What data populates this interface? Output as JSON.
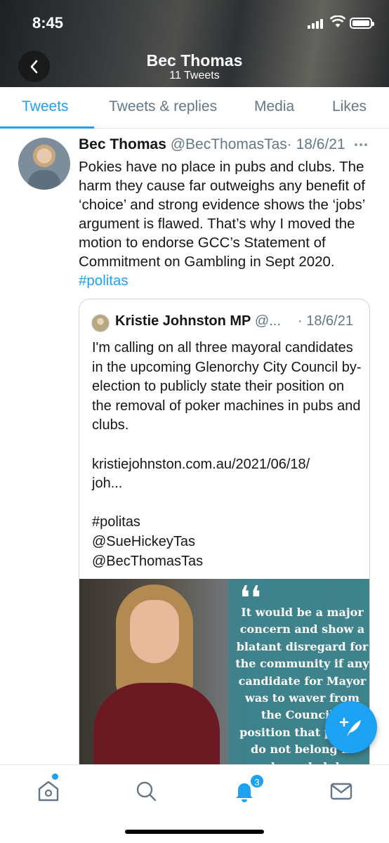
{
  "status_bar": {
    "time": "8:45"
  },
  "header": {
    "title": "Bec Thomas",
    "subtitle": "11 Tweets"
  },
  "tabs": [
    {
      "label": "Tweets",
      "active": true
    },
    {
      "label": "Tweets & replies"
    },
    {
      "label": "Media"
    },
    {
      "label": "Likes"
    }
  ],
  "tweet": {
    "name": "Bec Thomas",
    "handle": "@BecThomasTas",
    "date": "· 18/6/21",
    "text": "Pokies have no place in pubs and clubs. The harm they cause far outweighs any benefit of ‘choice’ and strong evidence shows the ‘jobs’ argument is flawed. That’s why I moved the motion to endorse GCC’s Statement of Commitment on Gambling in Sept 2020. ",
    "hashtag": "#politas"
  },
  "quote": {
    "name": "Kristie Johnston MP",
    "handle": "@...",
    "date": "· 18/6/21",
    "text": "I'm calling on all three mayoral candidates in the upcoming Glenorchy City Council by-election to publicly state their position on the removal of poker machines in pubs and clubs.\n\nkristiejohnston.com.au/2021/06/18/\njoh...\n\n#politas\n@SueHickeyTas\n@BecThomasTas",
    "image_quote_mark": "❛❛",
    "image_quote": "It would be a major concern and show a blatant disregard for the community if any candidate for Mayor was to waver from the Council's position that pokies do not belong in pubs and clubs"
  },
  "bottom_nav": {
    "notifications_count": "3",
    "items": [
      "home-icon",
      "search-icon",
      "notifications-icon",
      "messages-icon"
    ]
  },
  "colors": {
    "accent": "#1da1f2",
    "text": "#14171a",
    "secondary": "#657786"
  }
}
